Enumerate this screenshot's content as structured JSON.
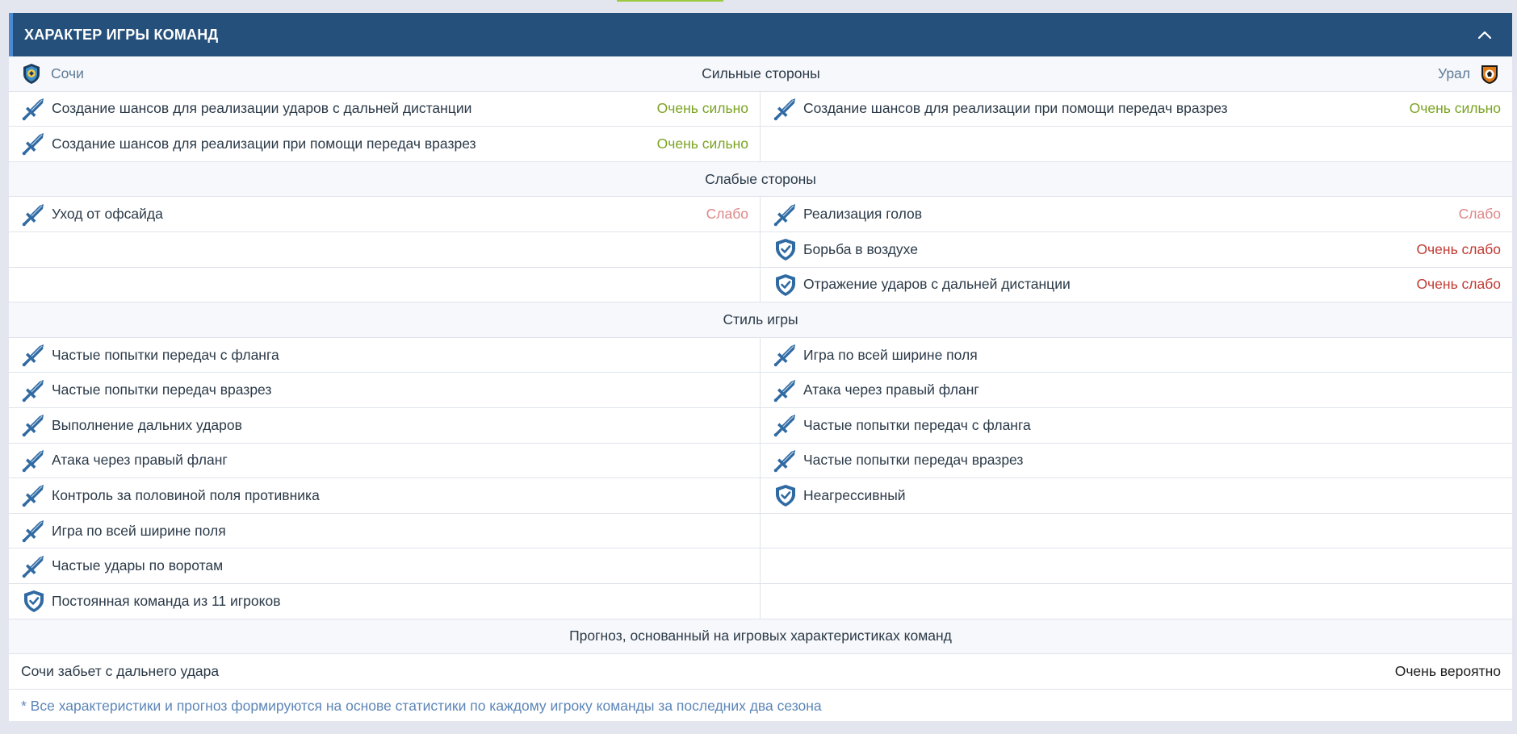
{
  "header": {
    "title": "ХАРАКТЕР ИГРЫ КОМАНД"
  },
  "teams": {
    "home": "Сочи",
    "away": "Урал"
  },
  "strengths": {
    "title": "Сильные стороны",
    "rows": [
      [
        {
          "icon": "sword-icon",
          "text": "Создание шансов для реализации ударов с дальней дистанции",
          "rating": "Очень сильно",
          "level": "very-strong"
        },
        {
          "icon": "sword-icon",
          "text": "Создание шансов для реализации при помощи передач вразрез",
          "rating": "Очень сильно",
          "level": "very-strong"
        }
      ],
      [
        {
          "icon": "sword-icon",
          "text": "Создание шансов для реализации при помощи передач вразрез",
          "rating": "Очень сильно",
          "level": "very-strong"
        },
        null
      ]
    ]
  },
  "weaknesses": {
    "title": "Слабые стороны",
    "rows": [
      [
        {
          "icon": "sword-icon",
          "text": "Уход от офсайда",
          "rating": "Слабо",
          "level": "weak"
        },
        {
          "icon": "sword-icon",
          "text": "Реализация голов",
          "rating": "Слабо",
          "level": "weak"
        }
      ],
      [
        null,
        {
          "icon": "shield-icon",
          "text": "Борьба в воздухе",
          "rating": "Очень слабо",
          "level": "very-weak"
        }
      ],
      [
        null,
        {
          "icon": "shield-icon",
          "text": "Отражение ударов с дальней дистанции",
          "rating": "Очень слабо",
          "level": "very-weak"
        }
      ]
    ]
  },
  "style": {
    "title": "Стиль игры",
    "rows": [
      [
        {
          "icon": "sword-icon",
          "text": "Частые попытки передач с фланга"
        },
        {
          "icon": "sword-icon",
          "text": "Игра по всей ширине поля"
        }
      ],
      [
        {
          "icon": "sword-icon",
          "text": "Частые попытки передач вразрез"
        },
        {
          "icon": "sword-icon",
          "text": "Атака через правый фланг"
        }
      ],
      [
        {
          "icon": "sword-icon",
          "text": "Выполнение дальних ударов"
        },
        {
          "icon": "sword-icon",
          "text": "Частые попытки передач с фланга"
        }
      ],
      [
        {
          "icon": "sword-icon",
          "text": "Атака через правый фланг"
        },
        {
          "icon": "sword-icon",
          "text": "Частые попытки передач вразрез"
        }
      ],
      [
        {
          "icon": "sword-icon",
          "text": "Контроль за половиной поля противника"
        },
        {
          "icon": "shield-icon",
          "text": "Неагрессивный"
        }
      ],
      [
        {
          "icon": "sword-icon",
          "text": "Игра по всей ширине поля"
        },
        null
      ],
      [
        {
          "icon": "sword-icon",
          "text": "Частые удары по воротам"
        },
        null
      ],
      [
        {
          "icon": "shield-icon",
          "text": "Постоянная команда из 11 игроков"
        },
        null
      ]
    ]
  },
  "forecast": {
    "title": "Прогноз, основанный на игровых характеристиках команд",
    "text": "Сочи забьет с дальнего удара",
    "value": "Очень вероятно"
  },
  "footnote": "* Все характеристики и прогноз формируются на основе статистики по каждому игроку команды за последних два сезона",
  "colors": {
    "header_bg": "#25507c",
    "very_strong": "#7aa321",
    "weak": "#e0878a",
    "very_weak": "#c23a33",
    "icon": "#2f6aa3"
  }
}
